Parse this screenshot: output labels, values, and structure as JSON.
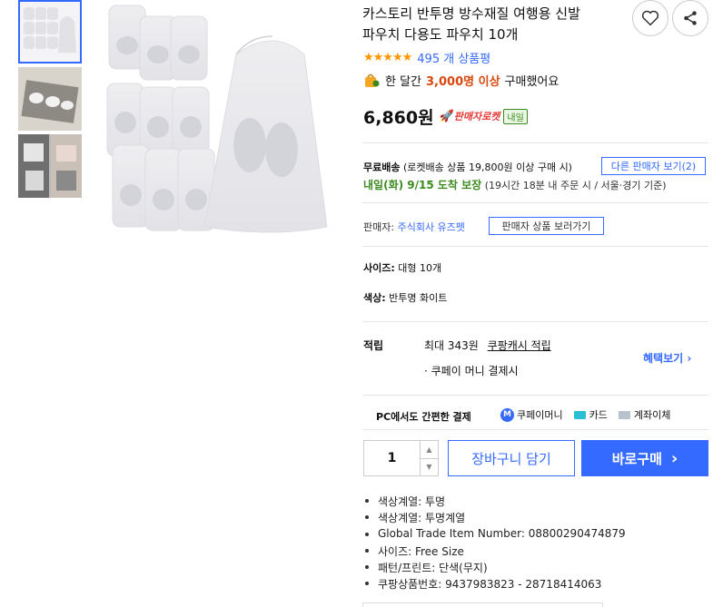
{
  "product": {
    "title_line1": "카스토리 반투명 방수재질 여행용 신발",
    "title_line2": "파우치 다용도 파우치 10개",
    "rating_stars": 5,
    "review_count": "495 개 상품평",
    "purchase_prefix": "한 달간",
    "purchase_count": "3,000명 이상",
    "purchase_suffix": "구매했어요",
    "price": "6,860원",
    "rocket_label": "판매자로켓",
    "rocket_badge": "내일"
  },
  "shipping": {
    "free_label": "무료배송",
    "condition": "(로켓배송 상품 19,800원 이상 구매 시)",
    "other_sellers": "다른 판매자 보기(2)",
    "arrival": "내일(화) 9/15 도착 보장",
    "arrival_note": "(19시간 18분 내 주문 시 / 서울⋅경기 기준)"
  },
  "seller": {
    "label": "판매자:",
    "name": "주식회사 유즈펫",
    "link": "판매자 상품 보러가기"
  },
  "options": {
    "size_label": "사이즈:",
    "size_value": "대형 10개",
    "color_label": "색상:",
    "color_value": "반투명 화이트"
  },
  "reward": {
    "label": "적립",
    "max": "최대 343원",
    "cash": "쿠팡캐시 적립",
    "note": "· 쿠페이 머니 결제시",
    "benefit": "혜택보기"
  },
  "payment": {
    "label": "PC에서도 간편한 결제",
    "coupay": "쿠페이머니",
    "card": "카드",
    "transfer": "계좌이체"
  },
  "cart": {
    "quantity": "1",
    "add_cart": "장바구니 담기",
    "buy_now": "바로구매"
  },
  "specs": [
    "색상계열: 투명",
    "색상계열: 투명계열",
    "Global Trade Item Number: 08800290474879",
    "사이즈: Free Size",
    "패턴/프린트: 단색(무지)",
    "쿠팡상품번호: 9437983823 - 28718414063"
  ],
  "colors": {
    "accent": "#346aff",
    "orange": "#d9480f",
    "green": "#3c8a1d",
    "star": "#ff9600"
  },
  "icons": [
    "heart-icon",
    "share-icon",
    "chevron-right-icon",
    "rocket-icon",
    "bag-icon",
    "card-icon",
    "bank-icon"
  ]
}
